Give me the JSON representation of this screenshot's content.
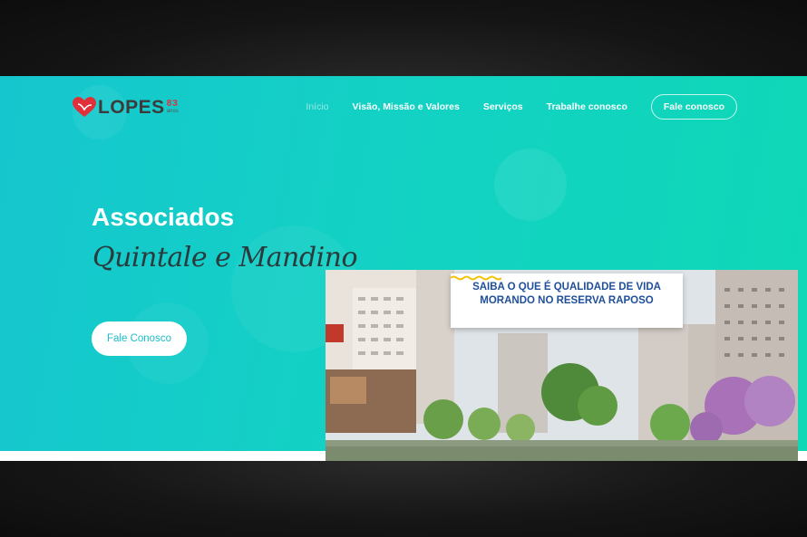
{
  "header": {
    "logo_text": "LOPES",
    "logo_number": "83",
    "logo_anos": "anos"
  },
  "nav": {
    "items": [
      {
        "label": "Início",
        "active": true
      },
      {
        "label": "Visão, Missão e Valores",
        "active": false
      },
      {
        "label": "Serviços",
        "active": false
      },
      {
        "label": "Trabalhe conosco",
        "active": false
      }
    ],
    "cta_label": "Fale conosco"
  },
  "hero": {
    "title": "Associados",
    "script_subtitle": "Quintale e Mandino",
    "button_label": "Fale Conosco"
  },
  "promo": {
    "caption_line1": "SAIBA O QUE É QUALIDADE DE VIDA",
    "caption_line2": "MORANDO NO RESERVA RAPOSO"
  },
  "colors": {
    "accent": "#13d1c4",
    "logo_heart": "#e0303a",
    "caption_blue": "#1f4f9a",
    "wave_yellow": "#f2c200"
  }
}
